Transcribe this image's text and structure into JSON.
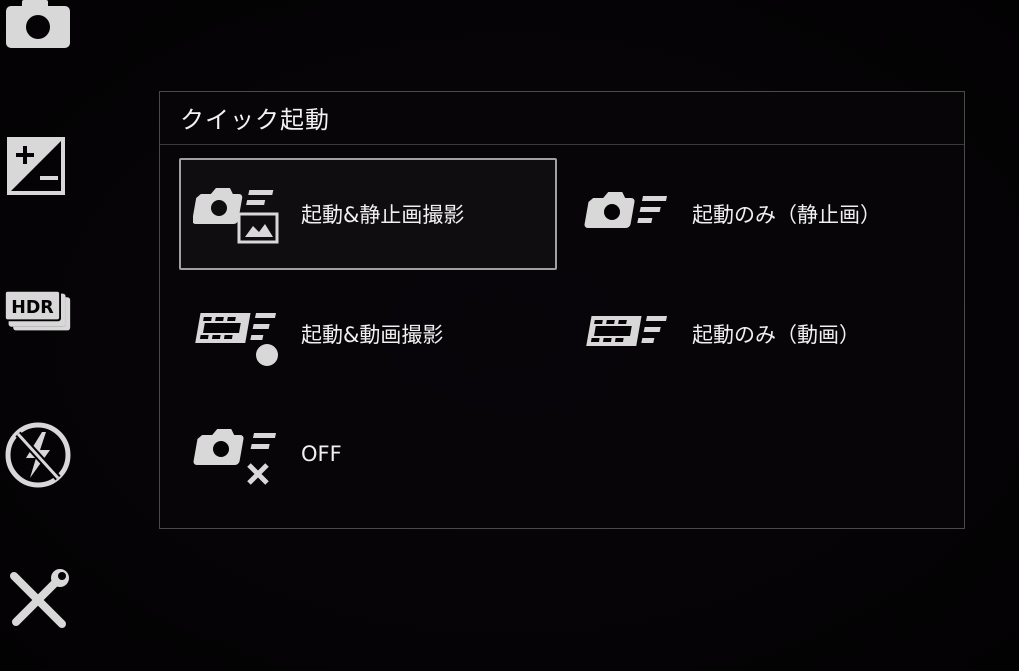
{
  "sidebar": {
    "items": [
      {
        "icon": "camera-icon"
      },
      {
        "icon": "exposure-compensation-icon"
      },
      {
        "icon": "hdr-icon",
        "text": "HDR"
      },
      {
        "icon": "flash-off-icon"
      },
      {
        "icon": "tools-icon"
      }
    ]
  },
  "dialog": {
    "title": "クイック起動",
    "options": [
      {
        "label": "起動&静止画撮影",
        "icon": "camera-capture-still-icon",
        "selected": true
      },
      {
        "label": "起動のみ（静止画）",
        "icon": "camera-launch-icon",
        "selected": false
      },
      {
        "label": "起動&動画撮影",
        "icon": "video-record-icon",
        "selected": false
      },
      {
        "label": "起動のみ（動画）",
        "icon": "video-launch-icon",
        "selected": false
      },
      {
        "label": "OFF",
        "icon": "quick-launch-off-icon",
        "selected": false
      }
    ]
  },
  "colors": {
    "background": "#050305",
    "dialog_border": "#4a4a4a",
    "selected_border": "#a0a0a0",
    "icon": "#d8d8d8",
    "text": "#f0f0f0"
  }
}
